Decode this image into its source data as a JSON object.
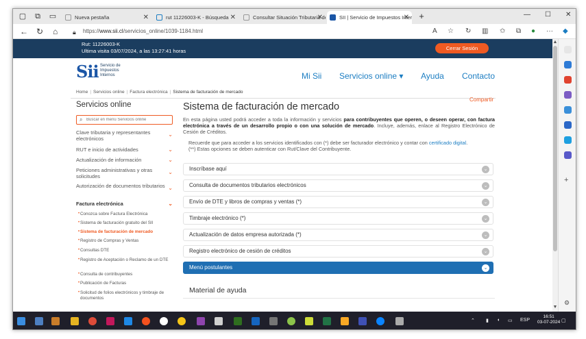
{
  "browser": {
    "tabs": [
      {
        "title": "Nueva pestaña"
      },
      {
        "title": "rut 11226003-K - Búsqueda"
      },
      {
        "title": "Consultar Situación Tributaria de"
      },
      {
        "title": "SII | Servicio de Impuestos Intern"
      }
    ],
    "url_prefix": "https://",
    "url_host": "www.sii.cl",
    "url_path": "/servicios_online/1039-1184.html"
  },
  "session": {
    "rut": "Rut: 11226003-K",
    "last_visit": "Ultima visita 03/07/2024, a las 13:27:41 horas",
    "logout_label": "Cerrar Sesión"
  },
  "header": {
    "logo_mark": "Sii",
    "logo_lines": [
      "Servicio de",
      "Impuestos",
      "Internos"
    ],
    "nav": [
      {
        "label": "Mi Sii"
      },
      {
        "label": "Servicios online ▾"
      },
      {
        "label": "Ayuda"
      },
      {
        "label": "Contacto"
      }
    ]
  },
  "breadcrumb": [
    "Home",
    "Servicios online",
    "Factura electrónica",
    "Sistema de facturación de mercado"
  ],
  "sidebar": {
    "title": "Servicios online",
    "search_placeholder": "Buscar en menú Servicios online",
    "menu": [
      {
        "label": "Clave tributaria y representantes electrónicos"
      },
      {
        "label": "RUT e inicio de actividades"
      },
      {
        "label": "Actualización de información"
      },
      {
        "label": "Peticiones administrativas y otras solicitudes"
      },
      {
        "label": "Autorización de documentos tributarios"
      },
      {
        "label": "Factura electrónica"
      }
    ],
    "submenu": [
      {
        "label": "Conozca sobre Factura Electrónica"
      },
      {
        "label": "Sistema de facturación gratuito del SII"
      },
      {
        "label": "Sistema de facturación de mercado"
      },
      {
        "label": "Registro de Compras y Ventas"
      },
      {
        "label": "Consultas DTE"
      },
      {
        "label": "Registro de Aceptación o Reclamo de un DTE"
      },
      {
        "label": "Consulta de contribuyentes"
      },
      {
        "label": "Publicación de Facturas"
      },
      {
        "label": "Solicitud de folios electrónicos y timbraje de documentos"
      }
    ]
  },
  "main": {
    "share": "Compartir",
    "title": "Sistema de facturación de mercado",
    "intro_a": "En esta página usted podrá acceder a toda la información y servicios ",
    "intro_b": "para contribuyentes que operen, o deseen operar, con factura electrónica a través de un desarrollo propio o con una solución de mercado",
    "intro_c": ". Incluye, además, enlace al Registro Electrónico de Cesión de Créditos.",
    "note_a": "Recuerde que para acceder a los servicios identificados con (*) debe ser facturador electrónico y contar con ",
    "note_link": "certificado digital",
    "note_b": ".",
    "note_c": "(**) Estas opciones se deben autenticar con Rut/Clave del Contribuyente.",
    "accordion": [
      {
        "label": "Inscríbase aquí"
      },
      {
        "label": "Consulta de documentos tributarios electrónicos"
      },
      {
        "label": "Envío de DTE y libros de compras y ventas (*)"
      },
      {
        "label": "Timbraje electrónico (*)"
      },
      {
        "label": "Actualización de datos empresa autorizada (*)"
      },
      {
        "label": "Registro electrónico de cesión de créditos"
      },
      {
        "label": "Menú postulantes"
      }
    ],
    "material_title": "Material de ayuda"
  },
  "taskbar": {
    "lang": "ESP",
    "time": "16:51",
    "date": "03-07-2024"
  },
  "colors": {
    "sii_dark": "#1b3d5f",
    "sii_orange": "#ef5a22",
    "sii_blue": "#1b7dc2",
    "accordion_active": "#1f6fb3"
  }
}
